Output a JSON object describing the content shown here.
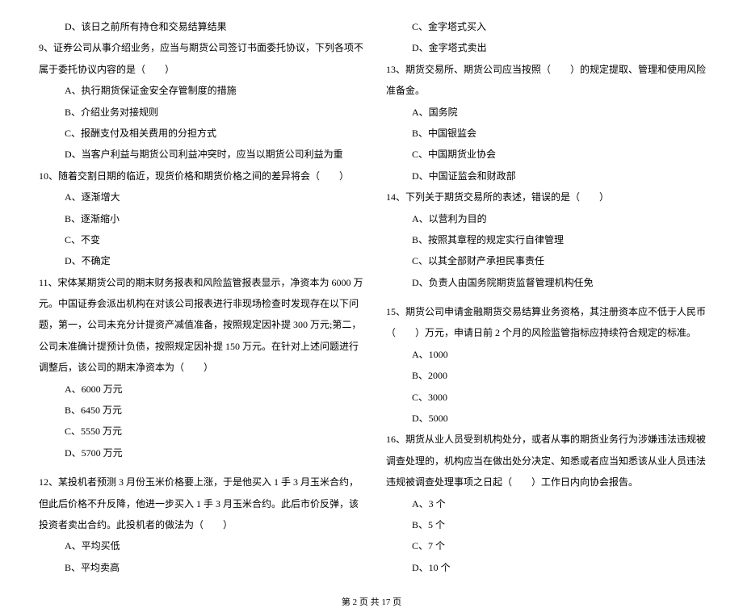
{
  "left_column": {
    "q8_opt_d": "D、该日之前所有持仓和交易结算结果",
    "q9": "9、证券公司从事介绍业务，应当与期货公司签订书面委托协议，下列各项不属于委托协议内容的是（　　）",
    "q9_opts": {
      "a": "A、执行期货保证金安全存管制度的措施",
      "b": "B、介绍业务对接规则",
      "c": "C、报酬支付及相关费用的分担方式",
      "d": "D、当客户利益与期货公司利益冲突时，应当以期货公司利益为重"
    },
    "q10": "10、随着交割日期的临近，现货价格和期货价格之间的差异将会（　　）",
    "q10_opts": {
      "a": "A、逐渐增大",
      "b": "B、逐渐缩小",
      "c": "C、不变",
      "d": "D、不确定"
    },
    "q11": "11、宋体某期货公司的期末财务报表和风险监管报表显示，净资本为 6000 万元。中国证券会派出机构在对该公司报表进行非现场检查时发现存在以下问题，第一，公司未充分计提资产减值准备，按照规定因补提 300 万元;第二，公司未准确计提预计负债，按照规定因补提 150 万元。在针对上述问题进行调整后，该公司的期末净资本为（　　）",
    "q11_opts": {
      "a": "A、6000 万元",
      "b": "B、6450 万元",
      "c": "C、5550 万元",
      "d": "D、5700 万元"
    },
    "q12": "12、某投机者预测 3 月份玉米价格要上涨，于是他买入 1 手 3 月玉米合约，但此后价格不升反降，他进一步买入 1 手 3 月玉米合约。此后市价反弹，该投资者卖出合约。此投机者的做法为（　　）",
    "q12_opts": {
      "a": "A、平均买低",
      "b": "B、平均卖高"
    }
  },
  "right_column": {
    "q12_opts": {
      "c": "C、金字塔式买入",
      "d": "D、金字塔式卖出"
    },
    "q13": "13、期货交易所、期货公司应当按照（　　）的规定提取、管理和使用风险准备金。",
    "q13_opts": {
      "a": "A、国务院",
      "b": "B、中国银监会",
      "c": "C、中国期货业协会",
      "d": "D、中国证监会和财政部"
    },
    "q14": "14、下列关于期货交易所的表述，错误的是（　　）",
    "q14_opts": {
      "a": "A、以营利为目的",
      "b": "B、按照其章程的规定实行自律管理",
      "c": "C、以其全部财产承担民事责任",
      "d": "D、负责人由国务院期货监督管理机构任免"
    },
    "q15": "15、期货公司申请金融期货交易结算业务资格，其注册资本应不低于人民币（　　）万元，申请日前 2 个月的风险监管指标应持续符合规定的标准。",
    "q15_opts": {
      "a": "A、1000",
      "b": "B、2000",
      "c": "C、3000",
      "d": "D、5000"
    },
    "q16": "16、期货从业人员受到机构处分，或者从事的期货业务行为涉嫌违法违规被调查处理的，机构应当在做出处分决定、知悉或者应当知悉该从业人员违法违规被调查处理事项之日起（　　）工作日内向协会报告。",
    "q16_opts": {
      "a": "A、3 个",
      "b": "B、5 个",
      "c": "C、7 个",
      "d": "D、10 个"
    }
  },
  "footer": "第 2 页 共 17 页"
}
